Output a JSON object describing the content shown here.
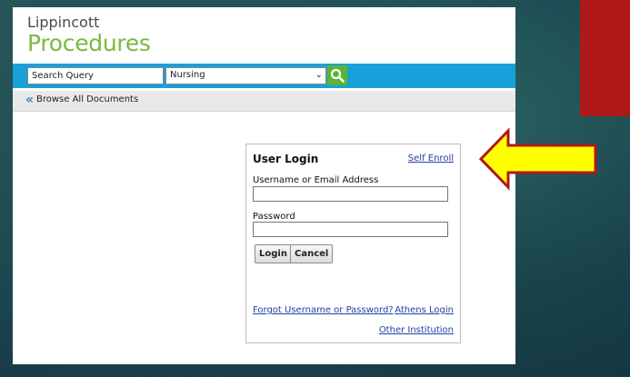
{
  "brand": {
    "line1": "Lippincott",
    "line2": "Procedures"
  },
  "search": {
    "input_value": "Search Query",
    "category_selected": "Nursing"
  },
  "browse": {
    "label": "Browse All Documents"
  },
  "login": {
    "title": "User Login",
    "self_enroll": "Self Enroll",
    "username_label": "Username or Email Address",
    "password_label": "Password",
    "login_button": "Login",
    "cancel_button": "Cancel",
    "forgot_link": "Forgot Username or Password?",
    "athens_link": "Athens Login",
    "other_link": "Other Institution"
  },
  "colors": {
    "brand_green": "#7ab93f",
    "search_bar_blue": "#1aa0d8",
    "search_button_green": "#5cb531",
    "arrow_fill": "#ffff00",
    "arrow_outline": "#b01818",
    "red_tab": "#b01818"
  },
  "icons": {
    "search_button": "magnifier-icon",
    "browse": "double-chevron-left-icon",
    "select": "chevron-down-icon",
    "pointer": "arrow-left-icon"
  }
}
